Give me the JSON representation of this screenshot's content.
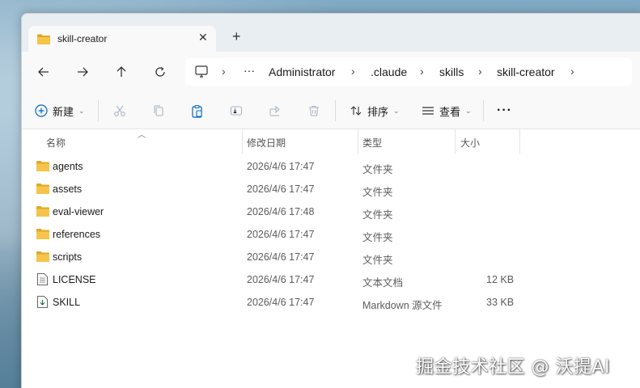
{
  "tab": {
    "title": "skill-creator",
    "close_glyph": "✕",
    "new_tab_glyph": "+"
  },
  "nav": {
    "back_icon": "arrow-left-icon",
    "forward_icon": "arrow-right-icon",
    "up_icon": "arrow-up-icon",
    "refresh_icon": "refresh-icon"
  },
  "address": {
    "overflow": "···",
    "separator": "›",
    "crumbs": [
      "Administrator",
      ".claude",
      "skills",
      "skill-creator"
    ]
  },
  "toolbar": {
    "new_label": "新建",
    "sort_label": "排序",
    "view_label": "查看",
    "more_label": "···"
  },
  "columns": {
    "name": "名称",
    "modified": "修改日期",
    "type": "类型",
    "size": "大小"
  },
  "files": [
    {
      "name": "agents",
      "modified": "2026/4/6 17:47",
      "type": "文件夹",
      "size": "",
      "icon": "folder-icon"
    },
    {
      "name": "assets",
      "modified": "2026/4/6 17:47",
      "type": "文件夹",
      "size": "",
      "icon": "folder-icon"
    },
    {
      "name": "eval-viewer",
      "modified": "2026/4/6 17:48",
      "type": "文件夹",
      "size": "",
      "icon": "folder-icon"
    },
    {
      "name": "references",
      "modified": "2026/4/6 17:47",
      "type": "文件夹",
      "size": "",
      "icon": "folder-icon"
    },
    {
      "name": "scripts",
      "modified": "2026/4/6 17:47",
      "type": "文件夹",
      "size": "",
      "icon": "folder-icon"
    },
    {
      "name": "LICENSE",
      "modified": "2026/4/6 17:47",
      "type": "文本文档",
      "size": "12 KB",
      "icon": "text-file-icon"
    },
    {
      "name": "SKILL",
      "modified": "2026/4/6 17:47",
      "type": "Markdown 源文件",
      "size": "33 KB",
      "icon": "markdown-file-icon"
    }
  ],
  "watermark": "掘金技术社区 @ 沃提AI",
  "colors": {
    "folder": "#f4c54a",
    "folder_dark": "#e0a82a",
    "accent": "#0067c0"
  }
}
